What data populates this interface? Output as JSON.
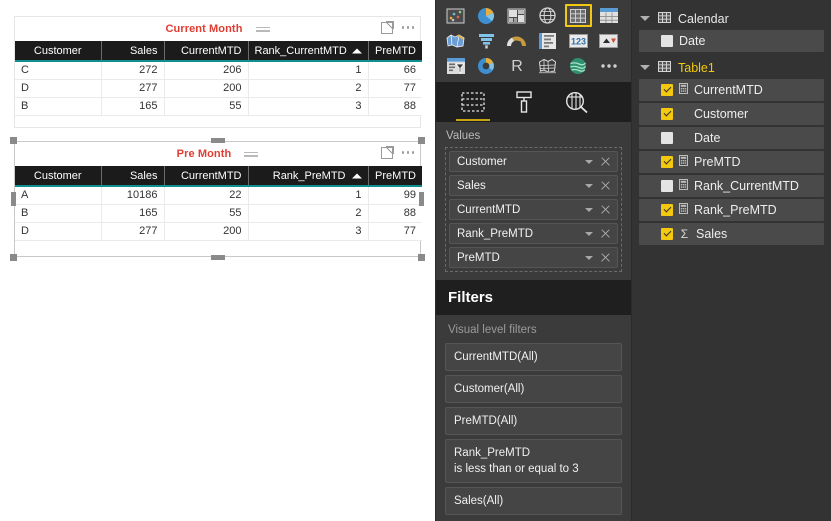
{
  "canvas": {
    "visuals": [
      {
        "title": "Current Month",
        "columns": [
          "Customer",
          "Sales",
          "CurrentMTD",
          "Rank_CurrentMTD",
          "PreMTD"
        ],
        "sort_column": "Rank_CurrentMTD",
        "sort_direction": "ascending",
        "rows": [
          [
            "C",
            "272",
            "206",
            "1",
            "66"
          ],
          [
            "D",
            "277",
            "200",
            "2",
            "77"
          ],
          [
            "B",
            "165",
            "55",
            "3",
            "88"
          ]
        ],
        "selected": false
      },
      {
        "title": "Pre Month",
        "columns": [
          "Customer",
          "Sales",
          "CurrentMTD",
          "Rank_PreMTD",
          "PreMTD"
        ],
        "sort_column": "Rank_PreMTD",
        "sort_direction": "ascending",
        "rows": [
          [
            "A",
            "10186",
            "22",
            "1",
            "99"
          ],
          [
            "B",
            "165",
            "55",
            "2",
            "88"
          ],
          [
            "D",
            "277",
            "200",
            "3",
            "77"
          ]
        ],
        "selected": true
      }
    ],
    "title_color": "#e03c31",
    "header_accent_color": "#0f8f8f"
  },
  "viz_panel": {
    "gallery": [
      {
        "name": "scatter-chart-icon",
        "selected": false
      },
      {
        "name": "pie-chart-icon",
        "selected": false
      },
      {
        "name": "treemap-icon",
        "selected": false
      },
      {
        "name": "map-icon",
        "selected": false
      },
      {
        "name": "table-icon",
        "selected": true
      },
      {
        "name": "matrix-icon",
        "selected": false
      },
      {
        "name": "filled-map-icon",
        "selected": false
      },
      {
        "name": "funnel-icon",
        "selected": false
      },
      {
        "name": "gauge-icon",
        "selected": false
      },
      {
        "name": "multi-row-card-icon",
        "selected": false
      },
      {
        "name": "card-icon",
        "selected": false
      },
      {
        "name": "kpi-icon",
        "selected": false
      },
      {
        "name": "slicer-icon",
        "selected": false
      },
      {
        "name": "donut-chart-icon",
        "selected": false
      },
      {
        "name": "r-script-visual-icon",
        "selected": false
      },
      {
        "name": "shape-map-icon",
        "selected": false
      },
      {
        "name": "arcgis-map-icon",
        "selected": false
      },
      {
        "name": "more-visuals-icon",
        "selected": false
      }
    ],
    "tabs": [
      {
        "name": "fields-tab",
        "active": true
      },
      {
        "name": "format-tab",
        "active": false
      },
      {
        "name": "analytics-tab",
        "active": false
      }
    ],
    "values_label": "Values",
    "value_fields": [
      "Customer",
      "Sales",
      "CurrentMTD",
      "Rank_PreMTD",
      "PreMTD"
    ],
    "filters_title": "Filters",
    "filters_subtitle": "Visual level filters",
    "filters": [
      {
        "label": "CurrentMTD(All)",
        "condition": ""
      },
      {
        "label": "Customer(All)",
        "condition": ""
      },
      {
        "label": "PreMTD(All)",
        "condition": ""
      },
      {
        "label": "Rank_PreMTD",
        "condition": "is less than or equal to 3"
      },
      {
        "label": "Sales(All)",
        "condition": ""
      }
    ],
    "accent_color": "#f2c811"
  },
  "fields_panel": {
    "tables": [
      {
        "name": "Calendar",
        "highlight": false,
        "expanded": true,
        "fields": [
          {
            "label": "Date",
            "checked": false,
            "measure": false,
            "aggregate": false
          }
        ]
      },
      {
        "name": "Table1",
        "highlight": true,
        "expanded": true,
        "fields": [
          {
            "label": "CurrentMTD",
            "checked": true,
            "measure": true,
            "aggregate": false
          },
          {
            "label": "Customer",
            "checked": true,
            "measure": false,
            "aggregate": false
          },
          {
            "label": "Date",
            "checked": false,
            "measure": false,
            "aggregate": false
          },
          {
            "label": "PreMTD",
            "checked": true,
            "measure": true,
            "aggregate": false
          },
          {
            "label": "Rank_CurrentMTD",
            "checked": false,
            "measure": true,
            "aggregate": false
          },
          {
            "label": "Rank_PreMTD",
            "checked": true,
            "measure": true,
            "aggregate": false
          },
          {
            "label": "Sales",
            "checked": true,
            "measure": false,
            "aggregate": true
          }
        ]
      }
    ]
  }
}
